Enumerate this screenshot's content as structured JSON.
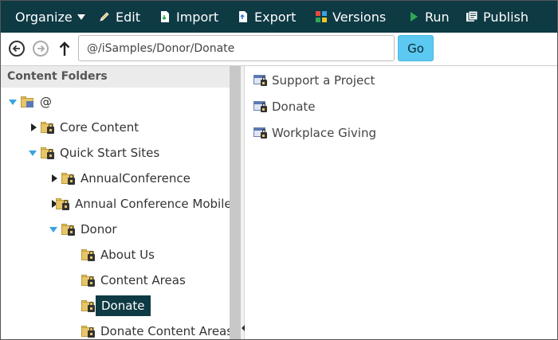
{
  "toolbar": {
    "organize": "Organize",
    "edit": "Edit",
    "import": "Import",
    "export": "Export",
    "versions": "Versions",
    "run": "Run",
    "publish": "Publish"
  },
  "address": {
    "path": "@/iSamples/Donor/Donate",
    "go": "Go"
  },
  "left_pane": {
    "header": "Content Folders",
    "tree": [
      {
        "label": "@",
        "toggle": "down",
        "selected": false
      },
      {
        "label": "Core Content",
        "toggle": "right",
        "selected": false
      },
      {
        "label": "Quick Start Sites",
        "toggle": "down",
        "selected": false
      },
      {
        "label": "AnnualConference",
        "toggle": "right",
        "selected": false
      },
      {
        "label": "Annual Conference Mobile",
        "toggle": "right",
        "selected": false
      },
      {
        "label": "Donor",
        "toggle": "down",
        "selected": false
      },
      {
        "label": "About Us",
        "toggle": "none",
        "selected": false
      },
      {
        "label": "Content Areas",
        "toggle": "none",
        "selected": false
      },
      {
        "label": "Donate",
        "toggle": "none",
        "selected": true
      },
      {
        "label": "Donate Content Areas",
        "toggle": "none",
        "selected": false
      }
    ]
  },
  "right_pane": {
    "items": [
      {
        "label": "Support a Project"
      },
      {
        "label": "Donate"
      },
      {
        "label": "Workplace Giving"
      }
    ]
  },
  "colors": {
    "toolbar_bg": "#0e3a44",
    "go_button": "#5bc9f1",
    "selected_bg": "#0e3a44",
    "expand_caret": "#3aa3e0",
    "run_icon": "#2fa84f"
  }
}
